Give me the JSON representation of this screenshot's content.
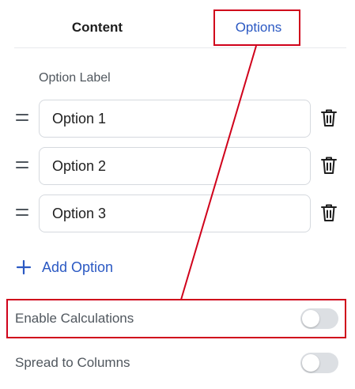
{
  "tabs": {
    "content": "Content",
    "options": "Options"
  },
  "section_label": "Option Label",
  "options": [
    "Option 1",
    "Option 2",
    "Option 3"
  ],
  "add_option": "Add Option",
  "settings": [
    {
      "label": "Enable Calculations",
      "enabled": false
    },
    {
      "label": "Spread to Columns",
      "enabled": false
    }
  ],
  "colors": {
    "accent": "#2b59c3",
    "highlight": "#d0021b",
    "toggle_off": "#dcdfe3"
  }
}
